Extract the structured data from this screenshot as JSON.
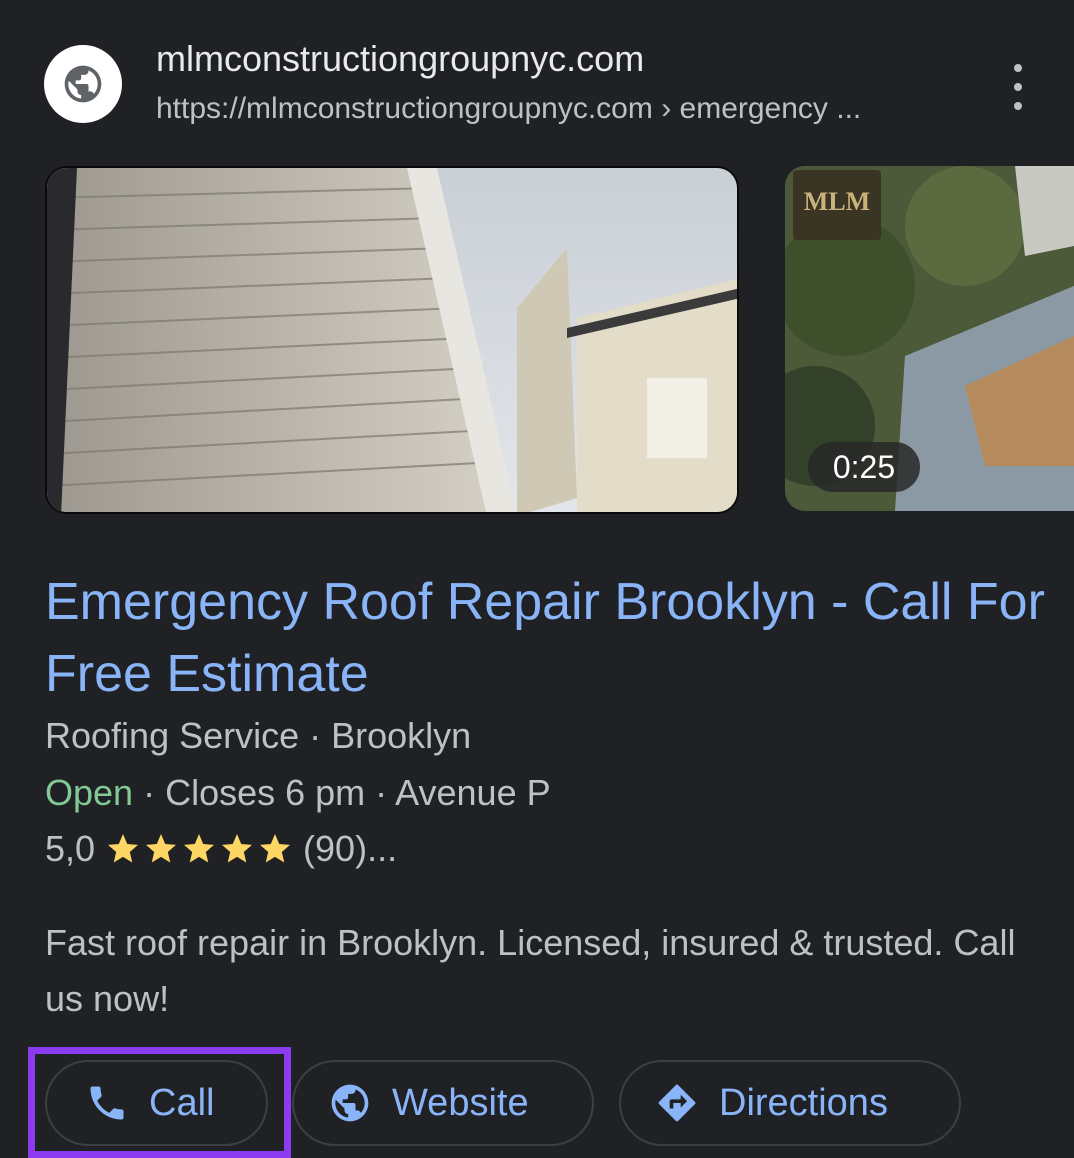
{
  "site": {
    "name": "mlmconstructiongroupnyc.com",
    "url": "https://mlmconstructiongroupnyc.com › emergency ..."
  },
  "media": {
    "video_duration": "0:25",
    "video_logo_text": "MLM"
  },
  "result": {
    "title": "Emergency Roof Repair Brooklyn - Call For Free Estimate",
    "category": "Roofing Service · Brooklyn",
    "status": "Open",
    "hours_rest": " · Closes 6 pm · Avenue P",
    "rating": "5,0",
    "stars": 5,
    "review_count": "(90)...",
    "description": "Fast roof repair in Brooklyn. Licensed, insured & trusted. Call us now!"
  },
  "actions": {
    "call": "Call",
    "website": "Website",
    "directions": "Directions"
  },
  "colors": {
    "background": "#202124",
    "link": "#8ab4f8",
    "open": "#81c995",
    "star": "#fdd663",
    "highlight": "#8c3cf0"
  }
}
